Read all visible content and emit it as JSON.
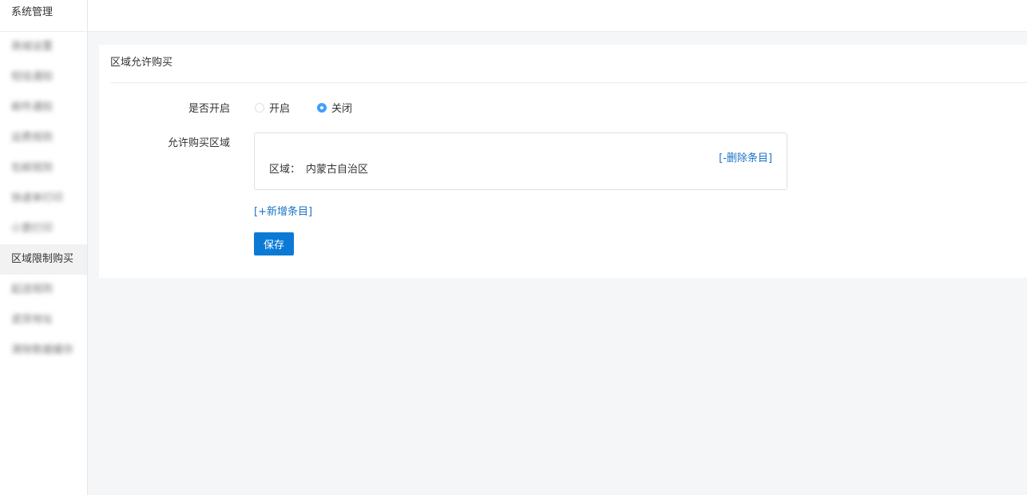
{
  "sidebar": {
    "title": "系统管理",
    "items": [
      {
        "label": "商城设置",
        "blurred": true
      },
      {
        "label": "短信通知",
        "blurred": true
      },
      {
        "label": "邮件通知",
        "blurred": true
      },
      {
        "label": "运费规则",
        "blurred": true
      },
      {
        "label": "包邮规则",
        "blurred": true
      },
      {
        "label": "快递单打印",
        "blurred": true
      },
      {
        "label": "小票打印",
        "blurred": true
      },
      {
        "label": "区域限制购买",
        "blurred": false,
        "active": true
      },
      {
        "label": "起送规则",
        "blurred": true
      },
      {
        "label": "退货地址",
        "blurred": true
      },
      {
        "label": "清除数据缓存",
        "blurred": true
      }
    ]
  },
  "panel": {
    "title": "区域允许购买",
    "enable_label": "是否开启",
    "radio_on_label": "开启",
    "radio_off_label": "关闭",
    "selected": "off",
    "regions_label": "允许购买区域",
    "region_entry": {
      "prefix": "区域：",
      "value": "内蒙古自治区",
      "delete_label": "[-删除条目]"
    },
    "add_label": "[+新增条目]",
    "save_label": "保存"
  },
  "colors": {
    "primary_button": "#0b7ad6",
    "link": "#1a73c8",
    "radio_checked": "#409eff"
  }
}
